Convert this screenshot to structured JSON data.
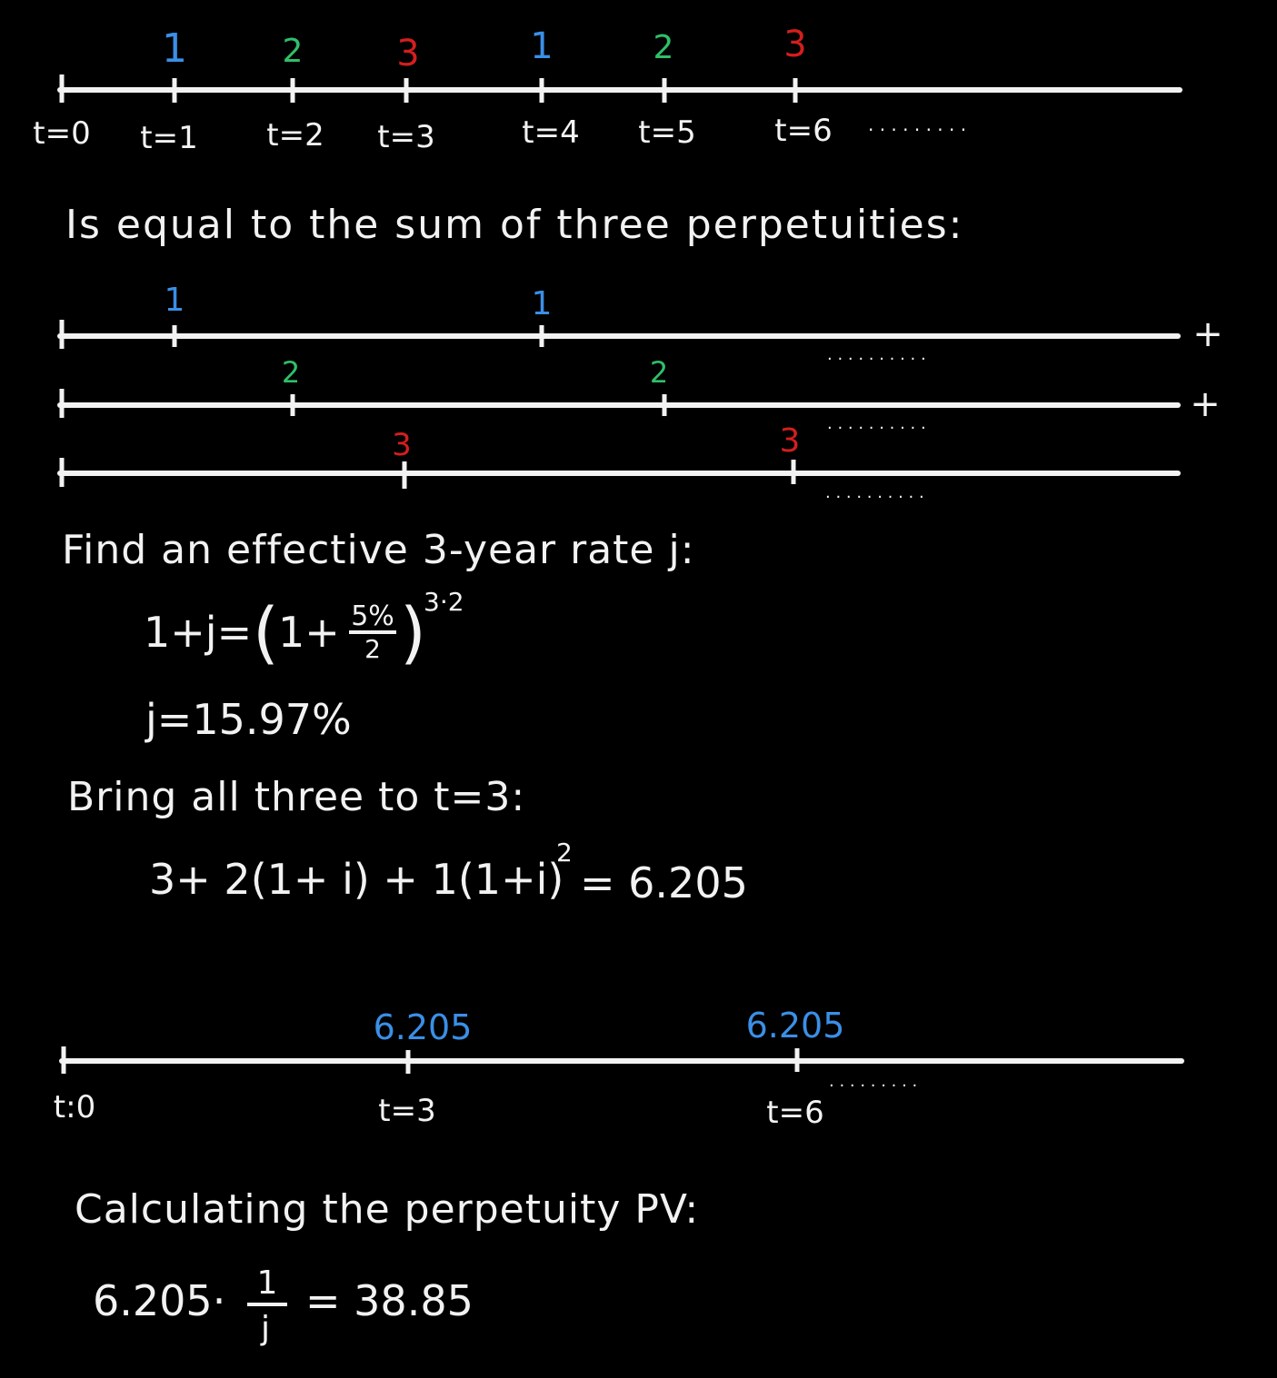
{
  "colors": {
    "background": "#000000",
    "ink": "#f2f2f2",
    "one": "#3b8fe6",
    "two": "#2fbf6a",
    "three": "#d41e1e",
    "result": "#3b8fe6"
  },
  "timeline_top": {
    "labels": [
      "t=0",
      "t=1",
      "t=2",
      "t=3",
      "t=4",
      "t=5",
      "t=6"
    ],
    "payments": [
      "1",
      "2",
      "3",
      "1",
      "2",
      "3"
    ],
    "ellipsis": ". . . . . . . . ."
  },
  "sentence1": "Is equal to the sum of three perpetuities:",
  "perpetuities": {
    "one": {
      "payment": "1",
      "plus": "+"
    },
    "two": {
      "payment": "2",
      "plus": "+"
    },
    "three": {
      "payment": "3"
    },
    "ellipsis": ". . . . . . . . . ."
  },
  "sentence2": "Find an effective 3-year rate j:",
  "eq1": {
    "lhs": "1+j=",
    "paren_open": "(",
    "one_plus": "1+",
    "num": "5%",
    "den": "2",
    "paren_close": ")",
    "exponent": "3·2"
  },
  "eq2": "j=15.97%",
  "sentence3": "Bring all three to t=3:",
  "eq3": {
    "main": "3+ 2(1+ i) + 1(1+i)",
    "exp": "2",
    "tail": "= 6.205"
  },
  "timeline_bottom": {
    "labels": [
      "t:0",
      "t=3",
      "t=6"
    ],
    "values": [
      "6.205",
      "6.205"
    ],
    "ellipsis": ". . . . . . . . ."
  },
  "sentence4": "Calculating the perpetuity PV:",
  "eq4": {
    "lhs": "6.205·",
    "num": "1",
    "den": "j",
    "rhs": "= 38.85"
  }
}
